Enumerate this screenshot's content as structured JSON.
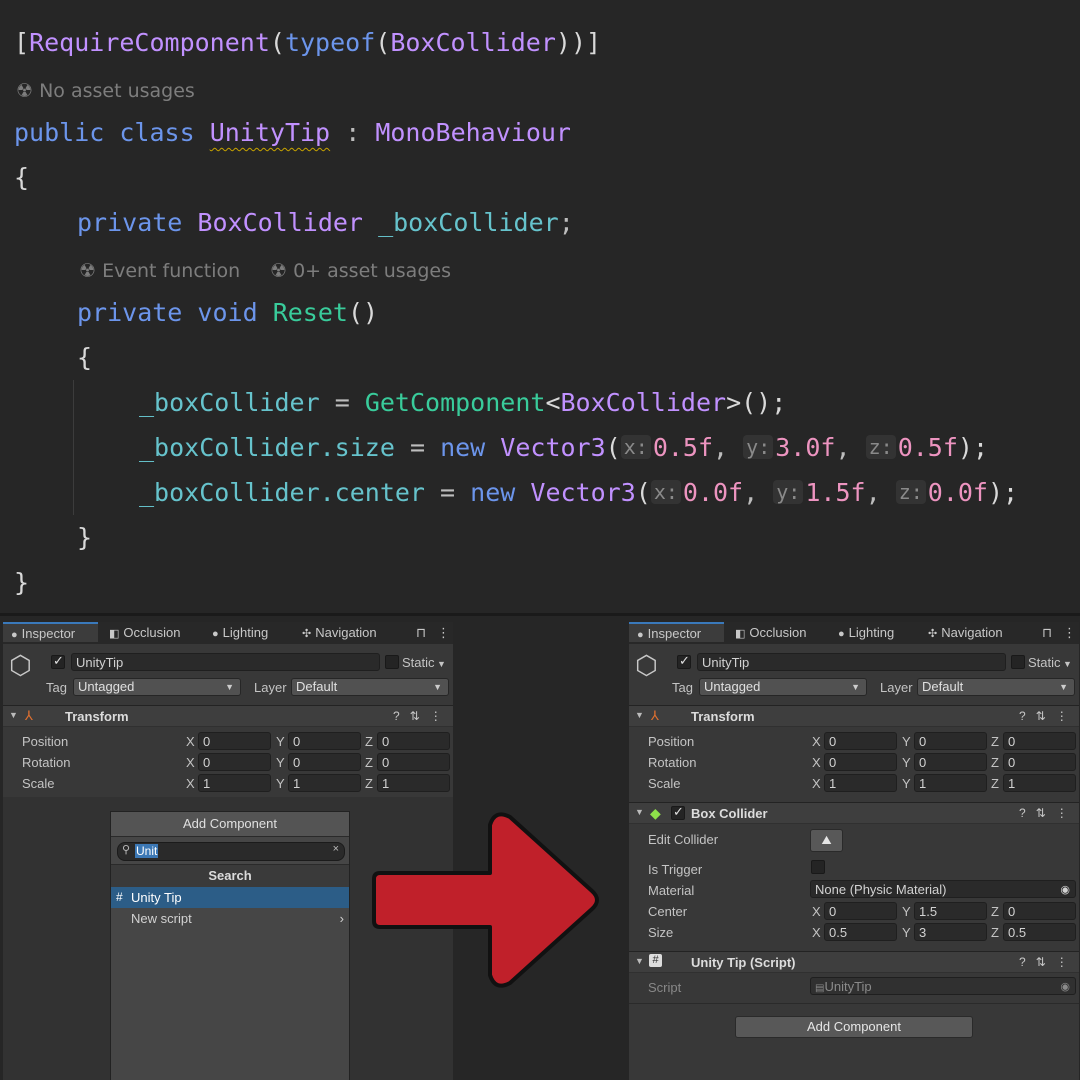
{
  "code": {
    "attribute": {
      "open": "[",
      "name": "RequireComponent",
      "paren_open": "(",
      "typeof": "typeof",
      "paren2": "(",
      "type": "BoxCollider",
      "close": "))]"
    },
    "hint_class": "No asset usages",
    "class_line": {
      "public": "public",
      "class": "class",
      "name": "UnityTip",
      "colon": ":",
      "base": "MonoBehaviour"
    },
    "brace_open": "{",
    "field_line": {
      "private": "private",
      "type": "BoxCollider",
      "name": "_boxCollider",
      "semi": ";"
    },
    "hint_event": "Event function",
    "hint_usages": "0+ asset usages",
    "method_line": {
      "private": "private",
      "void": "void",
      "name": "Reset",
      "parens": "()"
    },
    "inner_brace_open": "{",
    "line1": {
      "var": "_boxCollider",
      "eq": "=",
      "call": "GetComponent",
      "lt": "<",
      "type": "BoxCollider",
      "rest": ">();"
    },
    "line2": {
      "var": "_boxCollider",
      "member": ".size",
      "eq": "=",
      "new": "new",
      "ctor": "Vector3",
      "open": "(",
      "px": "x:",
      "vx": "0.5f",
      "py": "y:",
      "vy": "3.0f",
      "pz": "z:",
      "vz": "0.5f",
      "close": ");",
      "comma": ","
    },
    "line3": {
      "var": "_boxCollider",
      "member": ".center",
      "eq": "=",
      "new": "new",
      "ctor": "Vector3",
      "open": "(",
      "px": "x:",
      "vx": "0.0f",
      "py": "y:",
      "vy": "1.5f",
      "pz": "z:",
      "vz": "0.0f",
      "close": ");",
      "comma": ","
    },
    "inner_brace_close": "}",
    "brace_close": "}"
  },
  "tabs": [
    "Inspector",
    "Occlusion",
    "Lighting",
    "Navigation"
  ],
  "object": {
    "name": "UnityTip",
    "static_label": "Static",
    "tag_label": "Tag",
    "tag_value": "Untagged",
    "layer_label": "Layer",
    "layer_value": "Default"
  },
  "transform": {
    "title": "Transform",
    "rows": [
      {
        "label": "Position",
        "x": "0",
        "y": "0",
        "z": "0"
      },
      {
        "label": "Rotation",
        "x": "0",
        "y": "0",
        "z": "0"
      },
      {
        "label": "Scale",
        "x": "1",
        "y": "1",
        "z": "1"
      }
    ]
  },
  "axes": {
    "x": "X",
    "y": "Y",
    "z": "Z"
  },
  "add_component_popup": {
    "title": "Add Component",
    "search_value": "Unit",
    "subheader": "Search",
    "items": [
      "Unity Tip",
      "New script"
    ]
  },
  "box_collider": {
    "title": "Box Collider",
    "edit_collider_label": "Edit Collider",
    "is_trigger_label": "Is Trigger",
    "material_label": "Material",
    "material_value": "None (Physic Material)",
    "center_label": "Center",
    "center": {
      "x": "0",
      "y": "1.5",
      "z": "0"
    },
    "size_label": "Size",
    "size": {
      "x": "0.5",
      "y": "3",
      "z": "0.5"
    }
  },
  "script_component": {
    "title": "Unity Tip (Script)",
    "script_label": "Script",
    "script_value": "UnityTip"
  },
  "add_component_button": "Add Component",
  "colors": {
    "arrow": "#c0202a",
    "selection": "#2c5d87",
    "active_tab": "#3a79bb"
  }
}
